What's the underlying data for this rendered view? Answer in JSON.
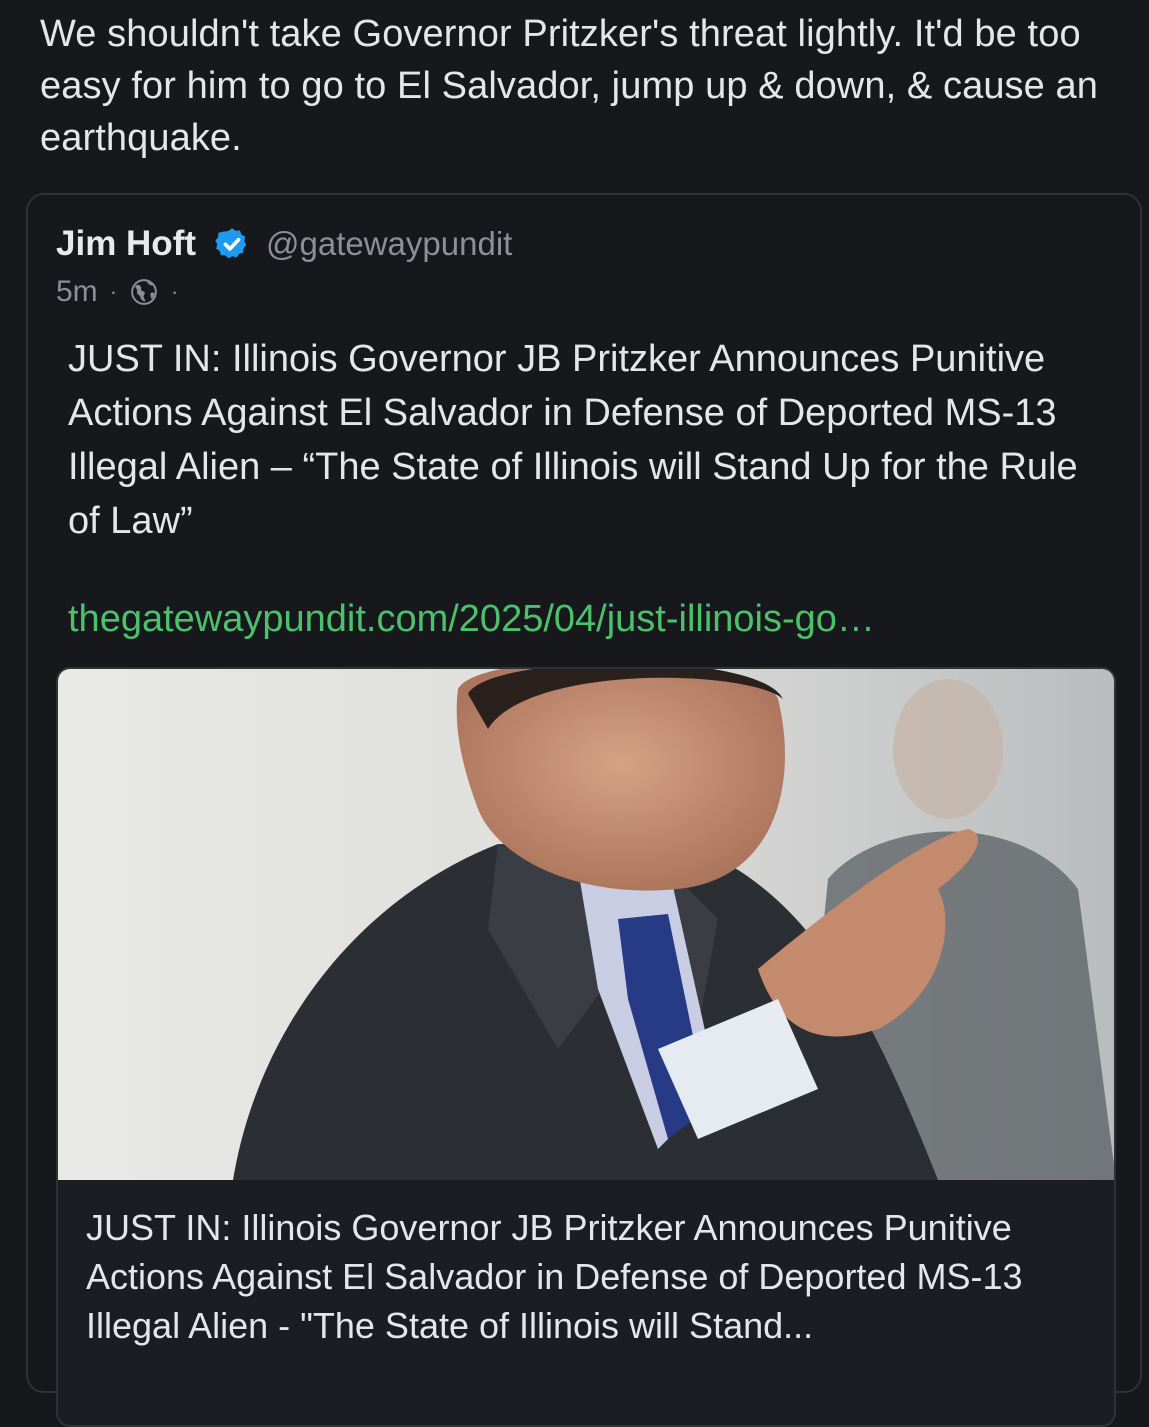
{
  "post": {
    "text": "We shouldn't take Governor Pritzker's threat lightly. It'd be too easy for him to go to El Salvador, jump up & down, & cause an earthquake."
  },
  "quoted": {
    "author_name": "Jim Hoft",
    "author_handle": "@gatewaypundit",
    "time": "5m",
    "separator": "·",
    "body": "JUST IN: Illinois Governor JB Pritzker Announces Punitive Actions Against El Salvador in Defense of Deported MS-13 Illegal Alien – “The State of Illinois will Stand Up for the Rule of Law”",
    "link_text": "thegatewaypundit.com/2025/04/just-illinois-go…",
    "verified_icon": "verified-badge-icon",
    "visibility_icon": "globe-icon",
    "link_card": {
      "title": "JUST IN: Illinois Governor JB Pritzker Announces Punitive Actions Against El Salvador in Defense of Deported MS-13 Illegal Alien - \"The State of Illinois will Stand..."
    }
  },
  "colors": {
    "background": "#17181c",
    "link": "#4cc06b",
    "verified": "#1d9bf0",
    "muted": "#8b8f96"
  }
}
